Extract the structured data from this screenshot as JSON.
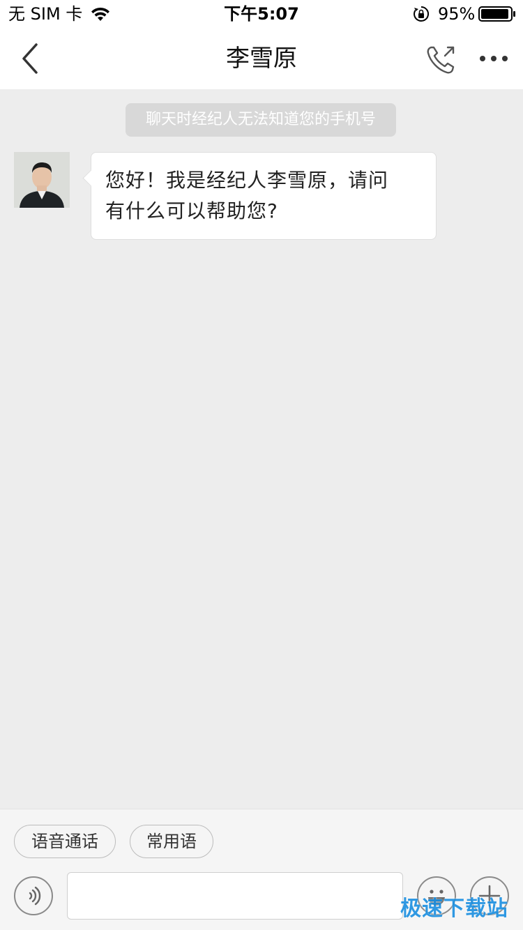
{
  "status_bar": {
    "carrier": "无 SIM 卡",
    "time": "下午5:07",
    "battery": "95%",
    "battery_level": 0.95,
    "icons": [
      "wifi-icon",
      "orientation-lock-icon",
      "battery-icon"
    ]
  },
  "nav": {
    "title": "李雪原",
    "icons": [
      "chevron-left-icon",
      "phone-call-icon",
      "more-icon"
    ]
  },
  "chat": {
    "system_notice": "聊天时经纪人无法知道您的手机号",
    "messages": [
      {
        "sender": "李雪原",
        "text_line1": "您好！我是经纪人李雪原，请问",
        "text_line2": "有什么可以帮助您?"
      }
    ]
  },
  "bottom": {
    "quick_actions": [
      "语音通话",
      "常用语"
    ],
    "input_placeholder": "",
    "icons": [
      "voice-icon",
      "emoji-icon",
      "plus-icon"
    ]
  },
  "watermark": "极速下载站",
  "colors": {
    "background": "#ededed",
    "bubble": "#ffffff",
    "notice": "#d8d8d8",
    "watermark": "#1a8fe0"
  }
}
